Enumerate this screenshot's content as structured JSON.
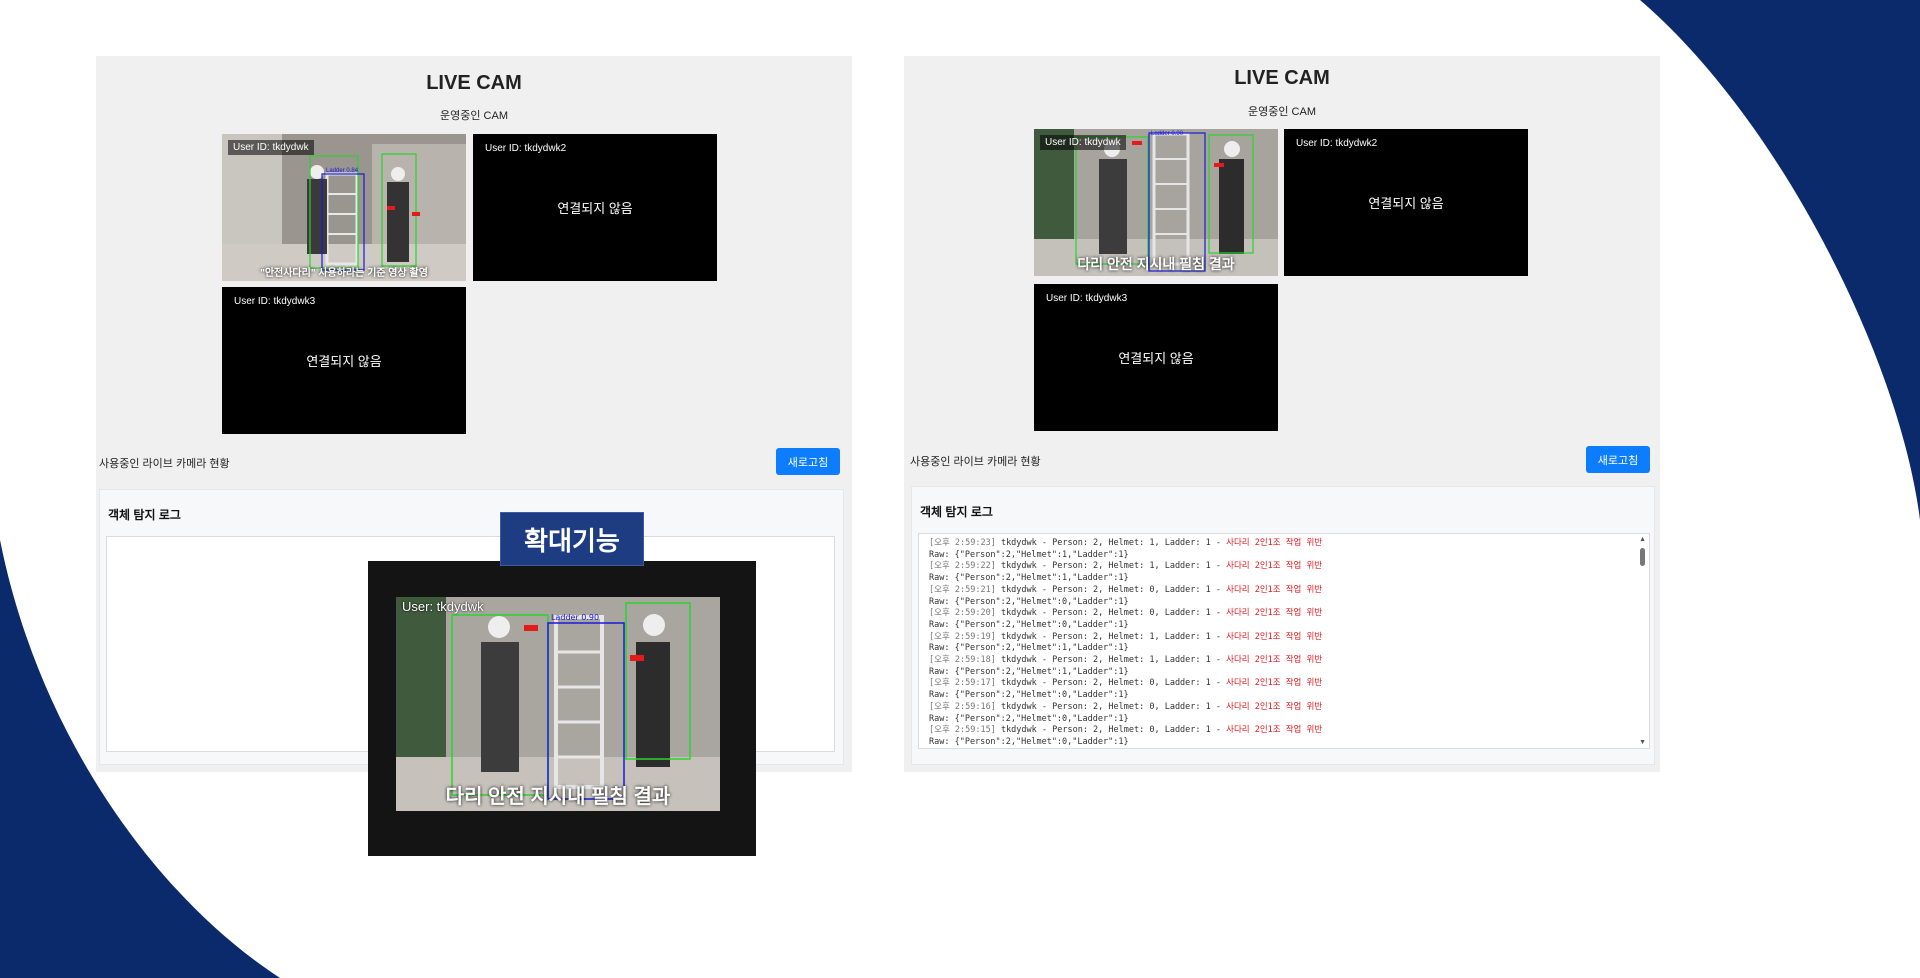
{
  "colors": {
    "background_navy": "#0b2a6b",
    "refresh_button": "#0d7dff",
    "warning_text": "#e5191d",
    "zoom_label_bg": "#1e3c82"
  },
  "left_panel": {
    "title": "LIVE CAM",
    "subtitle": "운영중인 CAM",
    "cams": [
      {
        "user_id": "User ID: tkdydwk",
        "status": "",
        "live": true,
        "caption": "\"안전사다리\" 사용하라는 기준 영상 촬영",
        "detections": [
          "Ladder 0.84"
        ]
      },
      {
        "user_id": "User ID: tkdydwk2",
        "status": "연결되지 않음",
        "live": false
      },
      {
        "user_id": "User ID: tkdydwk3",
        "status": "연결되지 않음",
        "live": false
      }
    ],
    "cam_caption": "사용중인 라이브 카메라 현황",
    "refresh_label": "새로고침",
    "log_title": "객체 탐지 로그"
  },
  "right_panel": {
    "title": "LIVE CAM",
    "subtitle": "운영중인 CAM",
    "cams": [
      {
        "user_id": "User ID: tkdydwk",
        "status": "",
        "live": true,
        "caption": "다리 안전 지시내 필침 결과",
        "detections": [
          "Ladder 0.90"
        ]
      },
      {
        "user_id": "User ID: tkdydwk2",
        "status": "연결되지 않음",
        "live": false
      },
      {
        "user_id": "User ID: tkdydwk3",
        "status": "연결되지 않음",
        "live": false
      }
    ],
    "cam_caption": "사용중인 라이브 카메라 현황",
    "refresh_label": "새로고침",
    "log_title": "객체 탐지 로그",
    "log_entries": [
      {
        "time": "[오후 2:59:23]",
        "text": " tkdydwk - Person: 2, Helmet: 1, Ladder: 1 - ",
        "warn": "사다리 2인1조 작업 위반",
        "raw": "Raw: {\"Person\":2,\"Helmet\":1,\"Ladder\":1}"
      },
      {
        "time": "[오후 2:59:22]",
        "text": " tkdydwk - Person: 2, Helmet: 1, Ladder: 1 - ",
        "warn": "사다리 2인1조 작업 위반",
        "raw": "Raw: {\"Person\":2,\"Helmet\":1,\"Ladder\":1}"
      },
      {
        "time": "[오후 2:59:21]",
        "text": " tkdydwk - Person: 2, Helmet: 0, Ladder: 1 - ",
        "warn": "사다리 2인1조 작업 위반",
        "raw": "Raw: {\"Person\":2,\"Helmet\":0,\"Ladder\":1}"
      },
      {
        "time": "[오후 2:59:20]",
        "text": " tkdydwk - Person: 2, Helmet: 0, Ladder: 1 - ",
        "warn": "사다리 2인1조 작업 위반",
        "raw": "Raw: {\"Person\":2,\"Helmet\":0,\"Ladder\":1}"
      },
      {
        "time": "[오후 2:59:19]",
        "text": " tkdydwk - Person: 2, Helmet: 1, Ladder: 1 - ",
        "warn": "사다리 2인1조 작업 위반",
        "raw": "Raw: {\"Person\":2,\"Helmet\":1,\"Ladder\":1}"
      },
      {
        "time": "[오후 2:59:18]",
        "text": " tkdydwk - Person: 2, Helmet: 1, Ladder: 1 - ",
        "warn": "사다리 2인1조 작업 위반",
        "raw": "Raw: {\"Person\":2,\"Helmet\":1,\"Ladder\":1}"
      },
      {
        "time": "[오후 2:59:17]",
        "text": " tkdydwk - Person: 2, Helmet: 0, Ladder: 1 - ",
        "warn": "사다리 2인1조 작업 위반",
        "raw": "Raw: {\"Person\":2,\"Helmet\":0,\"Ladder\":1}"
      },
      {
        "time": "[오후 2:59:16]",
        "text": " tkdydwk - Person: 2, Helmet: 0, Ladder: 1 - ",
        "warn": "사다리 2인1조 작업 위반",
        "raw": "Raw: {\"Person\":2,\"Helmet\":0,\"Ladder\":1}"
      },
      {
        "time": "[오후 2:59:15]",
        "text": " tkdydwk - Person: 2, Helmet: 0, Ladder: 1 - ",
        "warn": "사다리 2인1조 작업 위반",
        "raw": "Raw: {\"Person\":2,\"Helmet\":0,\"Ladder\":1}"
      }
    ]
  },
  "zoom_overlay": {
    "label": "확대기능",
    "user": "User: tkdydwk",
    "detections": [
      "Ladder 0.90"
    ],
    "caption": "다리 안전 지시내 필침 결과"
  }
}
